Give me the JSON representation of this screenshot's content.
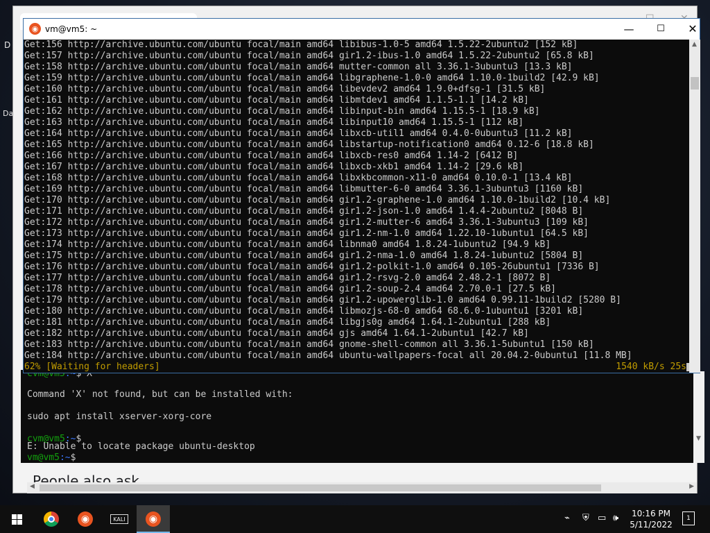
{
  "desktop": {
    "text_1": "D",
    "text_2": "Da"
  },
  "background_browser": {
    "page_heading": "People also ask",
    "min_glyph": "—",
    "max_glyph": "☐",
    "close_glyph": "✕"
  },
  "background_terminal": {
    "lines": [
      {
        "prompt_user": "cvm@vm5",
        "prompt_path": ":~",
        "text": "$ X"
      },
      {
        "text": ""
      },
      {
        "text": "Command 'X' not found, but can be installed with:"
      },
      {
        "text": ""
      },
      {
        "text": "sudo apt install xserver-xorg-core"
      },
      {
        "text": ""
      },
      {
        "prompt_user": "cvm@vm5",
        "prompt_path": ":~",
        "text": "$"
      },
      {
        "text": "E: Unable to locate package ubuntu-desktop"
      },
      {
        "prompt_user": "vm@vm5",
        "prompt_path": ":~",
        "text": "$"
      }
    ]
  },
  "window": {
    "title": "vm@vm5: ~",
    "minimize_glyph": "—",
    "maximize_glyph": "☐",
    "close_glyph": "✕"
  },
  "terminal": {
    "lines": [
      "Get:156 http://archive.ubuntu.com/ubuntu focal/main amd64 libibus-1.0-5 amd64 1.5.22-2ubuntu2 [152 kB]",
      "Get:157 http://archive.ubuntu.com/ubuntu focal/main amd64 gir1.2-ibus-1.0 amd64 1.5.22-2ubuntu2 [65.8 kB]",
      "Get:158 http://archive.ubuntu.com/ubuntu focal/main amd64 mutter-common all 3.36.1-3ubuntu3 [13.3 kB]",
      "Get:159 http://archive.ubuntu.com/ubuntu focal/main amd64 libgraphene-1.0-0 amd64 1.10.0-1build2 [42.9 kB]",
      "Get:160 http://archive.ubuntu.com/ubuntu focal/main amd64 libevdev2 amd64 1.9.0+dfsg-1 [31.5 kB]",
      "Get:161 http://archive.ubuntu.com/ubuntu focal/main amd64 libmtdev1 amd64 1.1.5-1.1 [14.2 kB]",
      "Get:162 http://archive.ubuntu.com/ubuntu focal/main amd64 libinput-bin amd64 1.15.5-1 [18.9 kB]",
      "Get:163 http://archive.ubuntu.com/ubuntu focal/main amd64 libinput10 amd64 1.15.5-1 [112 kB]",
      "Get:164 http://archive.ubuntu.com/ubuntu focal/main amd64 libxcb-util1 amd64 0.4.0-0ubuntu3 [11.2 kB]",
      "Get:165 http://archive.ubuntu.com/ubuntu focal/main amd64 libstartup-notification0 amd64 0.12-6 [18.8 kB]",
      "Get:166 http://archive.ubuntu.com/ubuntu focal/main amd64 libxcb-res0 amd64 1.14-2 [6412 B]",
      "Get:167 http://archive.ubuntu.com/ubuntu focal/main amd64 libxcb-xkb1 amd64 1.14-2 [29.6 kB]",
      "Get:168 http://archive.ubuntu.com/ubuntu focal/main amd64 libxkbcommon-x11-0 amd64 0.10.0-1 [13.4 kB]",
      "Get:169 http://archive.ubuntu.com/ubuntu focal/main amd64 libmutter-6-0 amd64 3.36.1-3ubuntu3 [1160 kB]",
      "Get:170 http://archive.ubuntu.com/ubuntu focal/main amd64 gir1.2-graphene-1.0 amd64 1.10.0-1build2 [10.4 kB]",
      "Get:171 http://archive.ubuntu.com/ubuntu focal/main amd64 gir1.2-json-1.0 amd64 1.4.4-2ubuntu2 [8048 B]",
      "Get:172 http://archive.ubuntu.com/ubuntu focal/main amd64 gir1.2-mutter-6 amd64 3.36.1-3ubuntu3 [109 kB]",
      "Get:173 http://archive.ubuntu.com/ubuntu focal/main amd64 gir1.2-nm-1.0 amd64 1.22.10-1ubuntu1 [64.5 kB]",
      "Get:174 http://archive.ubuntu.com/ubuntu focal/main amd64 libnma0 amd64 1.8.24-1ubuntu2 [94.9 kB]",
      "Get:175 http://archive.ubuntu.com/ubuntu focal/main amd64 gir1.2-nma-1.0 amd64 1.8.24-1ubuntu2 [5804 B]",
      "Get:176 http://archive.ubuntu.com/ubuntu focal/main amd64 gir1.2-polkit-1.0 amd64 0.105-26ubuntu1 [7336 B]",
      "Get:177 http://archive.ubuntu.com/ubuntu focal/main amd64 gir1.2-rsvg-2.0 amd64 2.48.2-1 [8072 B]",
      "Get:178 http://archive.ubuntu.com/ubuntu focal/main amd64 gir1.2-soup-2.4 amd64 2.70.0-1 [27.5 kB]",
      "Get:179 http://archive.ubuntu.com/ubuntu focal/main amd64 gir1.2-upowerglib-1.0 amd64 0.99.11-1build2 [5280 B]",
      "Get:180 http://archive.ubuntu.com/ubuntu focal/main amd64 libmozjs-68-0 amd64 68.6.0-1ubuntu1 [3201 kB]",
      "Get:181 http://archive.ubuntu.com/ubuntu focal/main amd64 libgjs0g amd64 1.64.1-2ubuntu1 [288 kB]",
      "Get:182 http://archive.ubuntu.com/ubuntu focal/main amd64 gjs amd64 1.64.1-2ubuntu1 [42.7 kB]",
      "Get:183 http://archive.ubuntu.com/ubuntu focal/main amd64 gnome-shell-common all 3.36.1-5ubuntu1 [150 kB]",
      "Get:184 http://archive.ubuntu.com/ubuntu focal/main amd64 ubuntu-wallpapers-focal all 20.04.2-0ubuntu1 [11.8 MB]"
    ],
    "status_left": "62% [Waiting for headers]",
    "status_right": "1540 kB/s 25s",
    "progress": 0.62
  },
  "taskbar": {
    "apps": [
      {
        "name": "start-button",
        "icon": "windows-logo-icon"
      },
      {
        "name": "chrome",
        "icon": "chrome-icon"
      },
      {
        "name": "ubuntu-1",
        "icon": "ubuntu-icon"
      },
      {
        "name": "kali",
        "icon": "kali-icon",
        "label": "KALI"
      },
      {
        "name": "ubuntu-2",
        "icon": "ubuntu-icon",
        "active": true
      }
    ],
    "clock_time": "10:16 PM",
    "clock_date": "5/11/2022",
    "notification_count": "1"
  },
  "colors": {
    "terminal_bg": "#0c0c0c",
    "terminal_fg": "#cccccc",
    "status_yellow": "#c19c00",
    "prompt_green": "#13a10e",
    "prompt_blue": "#3b78ff",
    "ubuntu_orange": "#e95420"
  }
}
